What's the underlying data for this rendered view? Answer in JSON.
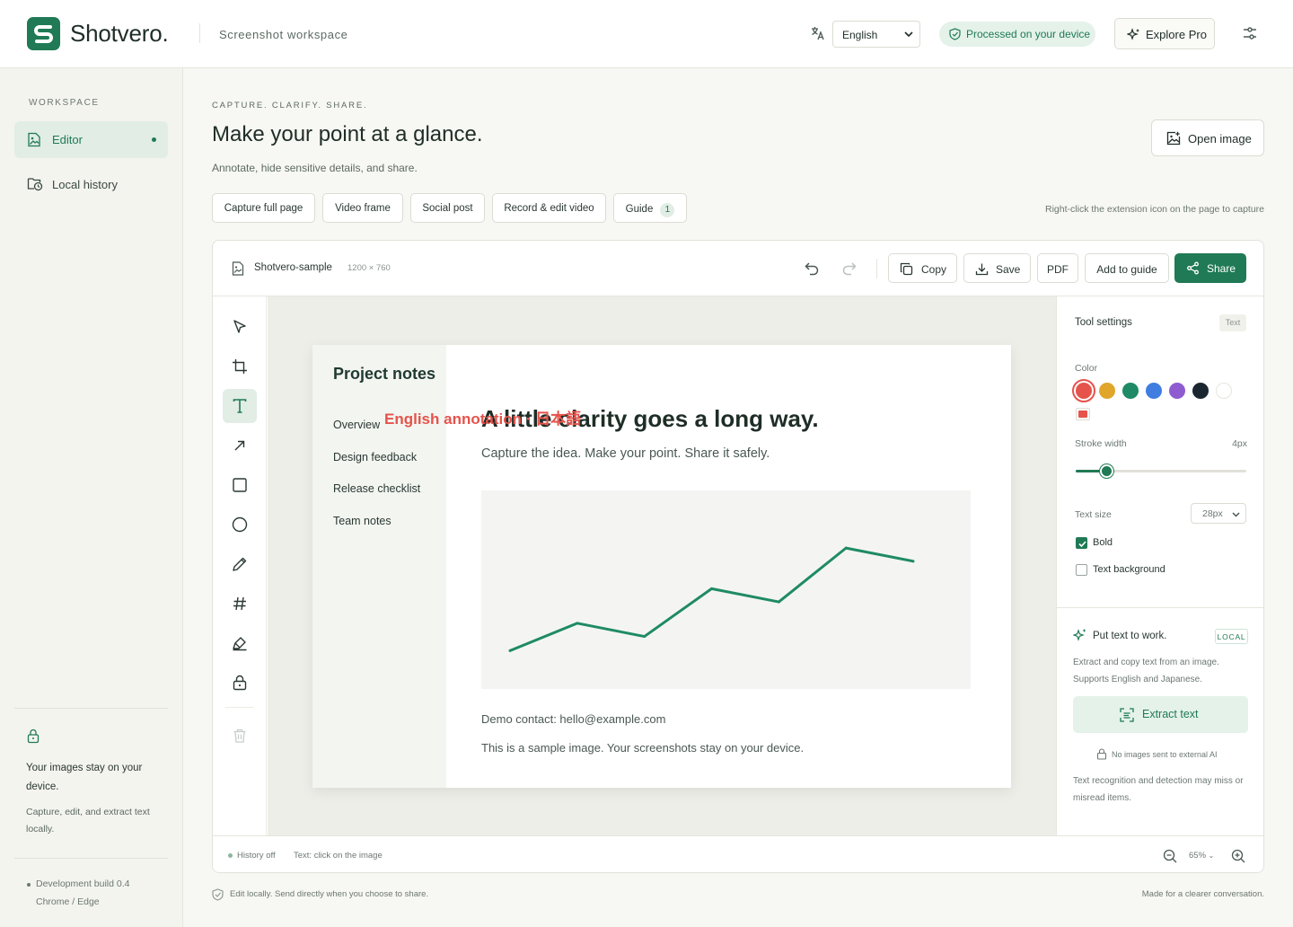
{
  "header": {
    "brand": "Shotvero.",
    "subtitle": "Screenshot workspace",
    "language": "English",
    "processed_badge": "Processed on your device",
    "explore_label": "Explore Pro"
  },
  "sidebar": {
    "section_label": "WORKSPACE",
    "items": [
      {
        "label": "Editor",
        "active": true
      },
      {
        "label": "Local history",
        "active": false
      }
    ],
    "privacy_title": "Your images stay on your device.",
    "privacy_desc": "Capture, edit, and extract text locally.",
    "build": "Development build 0.4",
    "browser": "Chrome / Edge"
  },
  "main": {
    "eyebrow": "CAPTURE. CLARIFY. SHARE.",
    "title": "Make your point at a glance.",
    "subtitle": "Annotate, hide sensitive details, and share.",
    "open_image": "Open image",
    "chips": [
      {
        "label": "Capture full page"
      },
      {
        "label": "Video frame"
      },
      {
        "label": "Social post"
      },
      {
        "label": "Record & edit video"
      },
      {
        "label": "Guide",
        "count": "1"
      }
    ],
    "hint": "Right-click the extension icon on the page to capture"
  },
  "editor": {
    "file_name": "Shotvero-sample",
    "file_dims": "1200 × 760",
    "copy_label": "Copy",
    "save_label": "Save",
    "pdf_label": "PDF",
    "guide_label": "Add to guide",
    "share_label": "Share",
    "tools": [
      "select-icon",
      "crop-icon",
      "text-icon",
      "arrow-icon",
      "rectangle-icon",
      "ellipse-icon",
      "pen-icon",
      "number-icon",
      "highlighter-icon",
      "blur-lock-icon",
      "trash-icon"
    ],
    "active_tool": "text-icon"
  },
  "document": {
    "sidebar_title": "Project notes",
    "nav": [
      "Overview",
      "Design feedback",
      "Release checklist",
      "Team notes"
    ],
    "heading": "A little clarity goes a long way.",
    "annotation": "English annotation · 日本語",
    "subheading": "Capture the idea. Make your point. Share it safely.",
    "contact": "Demo contact: hello@example.com",
    "note": "This is a sample image. Your screenshots stay on your device."
  },
  "chart_data": {
    "type": "line",
    "x": [
      1,
      2,
      3,
      4,
      5,
      6,
      7
    ],
    "series": [
      {
        "values": [
          2,
          4.7,
          3.4,
          8.1,
          6.8,
          12.1,
          10.8
        ],
        "color": "#1f8a66"
      }
    ],
    "ylim": [
      0,
      16
    ],
    "grid": false
  },
  "panel": {
    "title": "Tool settings",
    "badge": "Text",
    "color_label": "Color",
    "colors": [
      "#e5534b",
      "#e0a52b",
      "#1f8a66",
      "#3f7ee0",
      "#8e5bd0",
      "#1b2730",
      "#ffffff"
    ],
    "selected_color": "#e5534b",
    "stroke_label": "Stroke width",
    "stroke_value": "4px",
    "stroke_fraction": 0.18,
    "text_size_label": "Text size",
    "text_size_value": "28px",
    "bold_label": "Bold",
    "bold_checked": true,
    "textbg_label": "Text background",
    "textbg_checked": false,
    "ocr_title": "Put text to work.",
    "ocr_badge": "LOCAL",
    "ocr_desc": "Extract and copy text from an image. Supports English and Japanese.",
    "extract_label": "Extract text",
    "no_ai": "No images sent to external AI",
    "ocr_warn": "Text recognition and detection may miss or misread items."
  },
  "footer": {
    "history": "History off",
    "tool_hint": "Text: click on the image",
    "zoom": "65%",
    "bottom_left": "Edit locally. Send directly when you choose to share.",
    "bottom_right": "Made for a clearer conversation."
  }
}
